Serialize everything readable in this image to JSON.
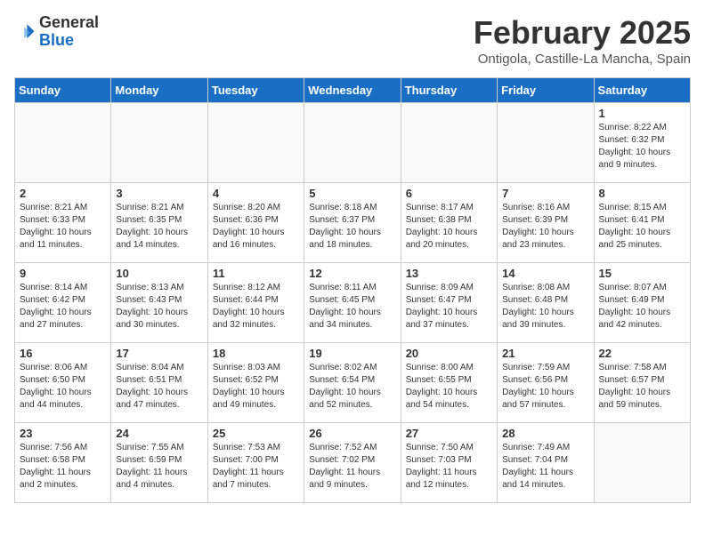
{
  "header": {
    "logo_line1": "General",
    "logo_line2": "Blue",
    "title": "February 2025",
    "subtitle": "Ontigola, Castille-La Mancha, Spain"
  },
  "weekdays": [
    "Sunday",
    "Monday",
    "Tuesday",
    "Wednesday",
    "Thursday",
    "Friday",
    "Saturday"
  ],
  "weeks": [
    [
      {
        "day": "",
        "info": ""
      },
      {
        "day": "",
        "info": ""
      },
      {
        "day": "",
        "info": ""
      },
      {
        "day": "",
        "info": ""
      },
      {
        "day": "",
        "info": ""
      },
      {
        "day": "",
        "info": ""
      },
      {
        "day": "1",
        "info": "Sunrise: 8:22 AM\nSunset: 6:32 PM\nDaylight: 10 hours\nand 9 minutes."
      }
    ],
    [
      {
        "day": "2",
        "info": "Sunrise: 8:21 AM\nSunset: 6:33 PM\nDaylight: 10 hours\nand 11 minutes."
      },
      {
        "day": "3",
        "info": "Sunrise: 8:21 AM\nSunset: 6:35 PM\nDaylight: 10 hours\nand 14 minutes."
      },
      {
        "day": "4",
        "info": "Sunrise: 8:20 AM\nSunset: 6:36 PM\nDaylight: 10 hours\nand 16 minutes."
      },
      {
        "day": "5",
        "info": "Sunrise: 8:18 AM\nSunset: 6:37 PM\nDaylight: 10 hours\nand 18 minutes."
      },
      {
        "day": "6",
        "info": "Sunrise: 8:17 AM\nSunset: 6:38 PM\nDaylight: 10 hours\nand 20 minutes."
      },
      {
        "day": "7",
        "info": "Sunrise: 8:16 AM\nSunset: 6:39 PM\nDaylight: 10 hours\nand 23 minutes."
      },
      {
        "day": "8",
        "info": "Sunrise: 8:15 AM\nSunset: 6:41 PM\nDaylight: 10 hours\nand 25 minutes."
      }
    ],
    [
      {
        "day": "9",
        "info": "Sunrise: 8:14 AM\nSunset: 6:42 PM\nDaylight: 10 hours\nand 27 minutes."
      },
      {
        "day": "10",
        "info": "Sunrise: 8:13 AM\nSunset: 6:43 PM\nDaylight: 10 hours\nand 30 minutes."
      },
      {
        "day": "11",
        "info": "Sunrise: 8:12 AM\nSunset: 6:44 PM\nDaylight: 10 hours\nand 32 minutes."
      },
      {
        "day": "12",
        "info": "Sunrise: 8:11 AM\nSunset: 6:45 PM\nDaylight: 10 hours\nand 34 minutes."
      },
      {
        "day": "13",
        "info": "Sunrise: 8:09 AM\nSunset: 6:47 PM\nDaylight: 10 hours\nand 37 minutes."
      },
      {
        "day": "14",
        "info": "Sunrise: 8:08 AM\nSunset: 6:48 PM\nDaylight: 10 hours\nand 39 minutes."
      },
      {
        "day": "15",
        "info": "Sunrise: 8:07 AM\nSunset: 6:49 PM\nDaylight: 10 hours\nand 42 minutes."
      }
    ],
    [
      {
        "day": "16",
        "info": "Sunrise: 8:06 AM\nSunset: 6:50 PM\nDaylight: 10 hours\nand 44 minutes."
      },
      {
        "day": "17",
        "info": "Sunrise: 8:04 AM\nSunset: 6:51 PM\nDaylight: 10 hours\nand 47 minutes."
      },
      {
        "day": "18",
        "info": "Sunrise: 8:03 AM\nSunset: 6:52 PM\nDaylight: 10 hours\nand 49 minutes."
      },
      {
        "day": "19",
        "info": "Sunrise: 8:02 AM\nSunset: 6:54 PM\nDaylight: 10 hours\nand 52 minutes."
      },
      {
        "day": "20",
        "info": "Sunrise: 8:00 AM\nSunset: 6:55 PM\nDaylight: 10 hours\nand 54 minutes."
      },
      {
        "day": "21",
        "info": "Sunrise: 7:59 AM\nSunset: 6:56 PM\nDaylight: 10 hours\nand 57 minutes."
      },
      {
        "day": "22",
        "info": "Sunrise: 7:58 AM\nSunset: 6:57 PM\nDaylight: 10 hours\nand 59 minutes."
      }
    ],
    [
      {
        "day": "23",
        "info": "Sunrise: 7:56 AM\nSunset: 6:58 PM\nDaylight: 11 hours\nand 2 minutes."
      },
      {
        "day": "24",
        "info": "Sunrise: 7:55 AM\nSunset: 6:59 PM\nDaylight: 11 hours\nand 4 minutes."
      },
      {
        "day": "25",
        "info": "Sunrise: 7:53 AM\nSunset: 7:00 PM\nDaylight: 11 hours\nand 7 minutes."
      },
      {
        "day": "26",
        "info": "Sunrise: 7:52 AM\nSunset: 7:02 PM\nDaylight: 11 hours\nand 9 minutes."
      },
      {
        "day": "27",
        "info": "Sunrise: 7:50 AM\nSunset: 7:03 PM\nDaylight: 11 hours\nand 12 minutes."
      },
      {
        "day": "28",
        "info": "Sunrise: 7:49 AM\nSunset: 7:04 PM\nDaylight: 11 hours\nand 14 minutes."
      },
      {
        "day": "",
        "info": ""
      }
    ]
  ]
}
